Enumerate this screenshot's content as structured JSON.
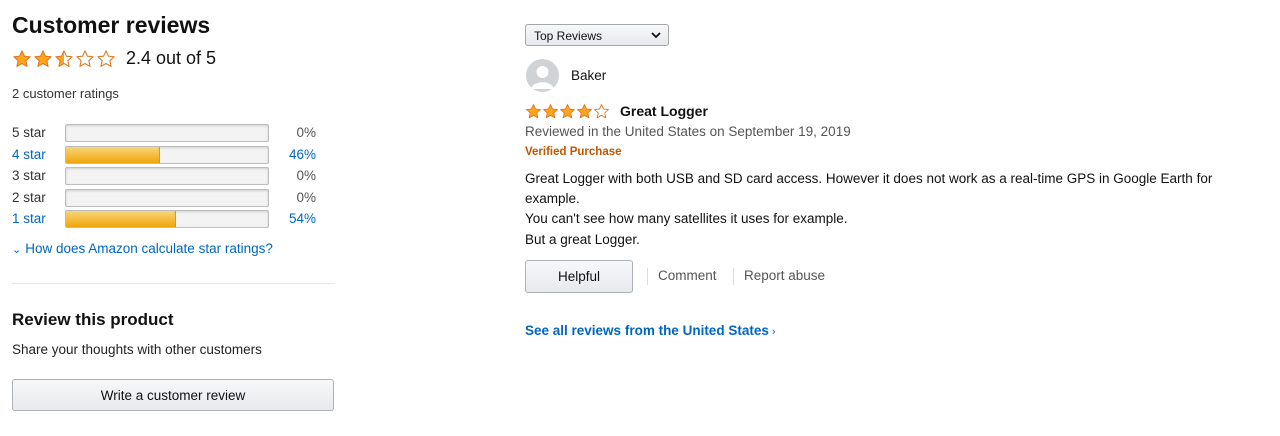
{
  "summary": {
    "title": "Customer reviews",
    "rating_value": 2.4,
    "rating_text": "2.4 out of 5",
    "ratings_count_text": "2 customer ratings",
    "star_color": "#ffa41c"
  },
  "histogram": [
    {
      "label": "5 star",
      "percent_text": "0%",
      "percent": 0,
      "link": false
    },
    {
      "label": "4 star",
      "percent_text": "46%",
      "percent": 46,
      "link": true
    },
    {
      "label": "3 star",
      "percent_text": "0%",
      "percent": 0,
      "link": false
    },
    {
      "label": "2 star",
      "percent_text": "0%",
      "percent": 0,
      "link": false
    },
    {
      "label": "1 star",
      "percent_text": "54%",
      "percent": 54,
      "link": true
    }
  ],
  "how_calculated": "How does Amazon calculate star ratings?",
  "review_product": {
    "title": "Review this product",
    "subtitle": "Share your thoughts with other customers",
    "button_label": "Write a customer review"
  },
  "sort": {
    "selected": "Top Reviews"
  },
  "review": {
    "reviewer": "Baker",
    "rating": 4,
    "title": "Great Logger",
    "date_text": "Reviewed in the United States on September 19, 2019",
    "verified_text": "Verified Purchase",
    "body_lines": [
      "Great Logger with both USB and SD card access. However it does not work as a real-time GPS in Google Earth for",
      "example.",
      "You can't see how many satellites it uses for example.",
      "But a great Logger."
    ],
    "helpful_label": "Helpful",
    "comment_label": "Comment",
    "report_label": "Report abuse"
  },
  "see_all": "See all reviews from the United States",
  "colors": {
    "link": "#0066c0",
    "verified": "#c45500",
    "bar_fill": "#f0a50a"
  }
}
